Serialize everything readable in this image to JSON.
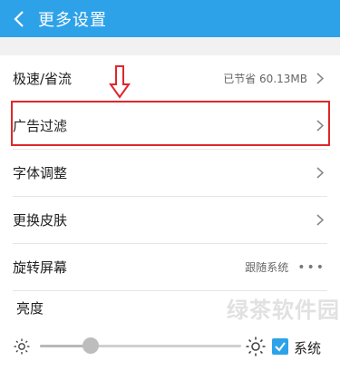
{
  "header": {
    "title": "更多设置",
    "back_icon": "chevron-left-icon",
    "color": "#2ea2e9"
  },
  "settings": {
    "speed": {
      "label": "极速/省流",
      "value": "已节省 60.13MB"
    },
    "ad_filter": {
      "label": "广告过滤"
    },
    "font": {
      "label": "字体调整"
    },
    "skin": {
      "label": "更换皮肤"
    },
    "rotate": {
      "label": "旋转屏幕",
      "value": "跟随系统"
    }
  },
  "brightness": {
    "label": "亮度",
    "level_fraction": 0.25,
    "system_label": "系统",
    "system_checked": true
  },
  "annotation": {
    "highlight_color": "#e0262a"
  },
  "watermark": "绿茶软件园"
}
